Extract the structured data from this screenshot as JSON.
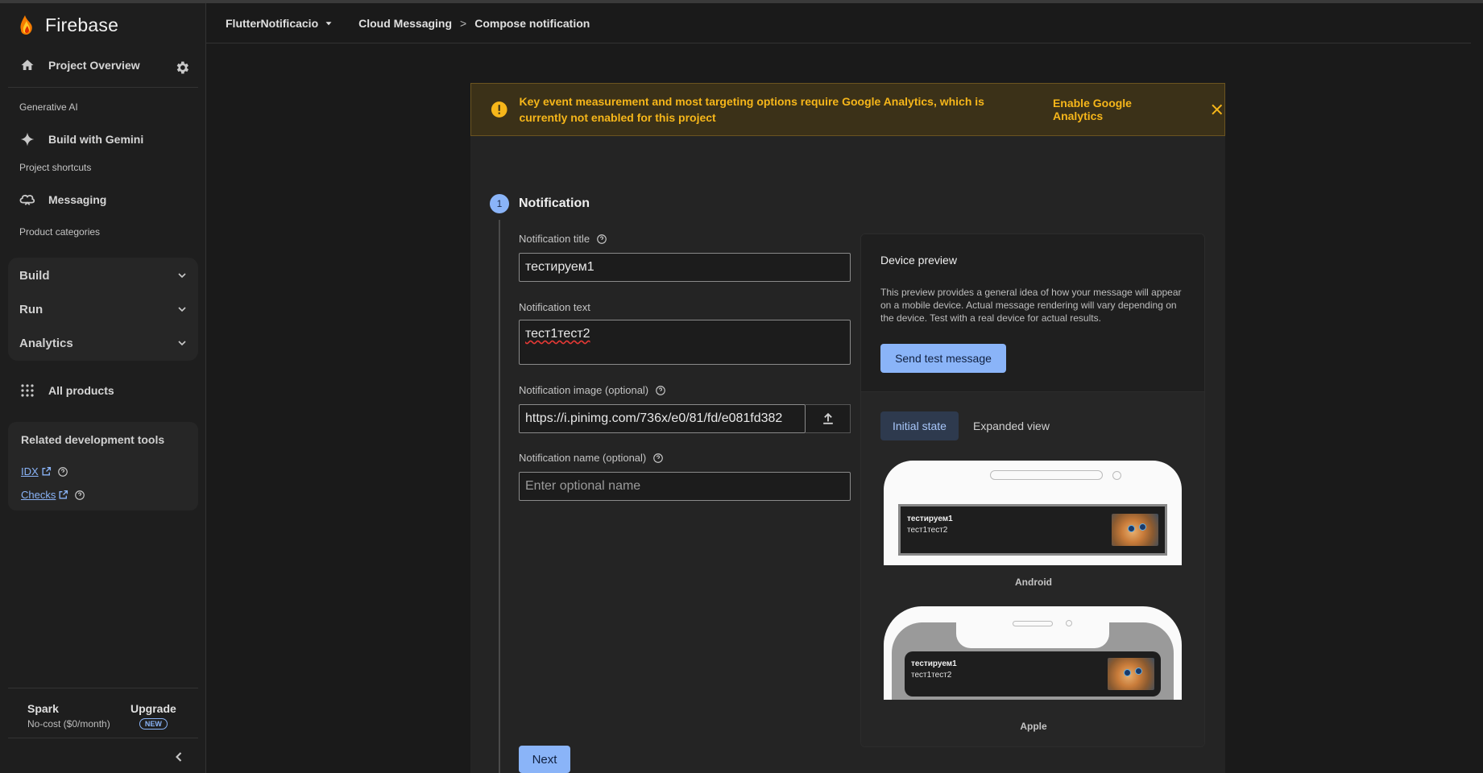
{
  "brand": {
    "name": "Firebase"
  },
  "sidebar": {
    "project_overview": "Project Overview",
    "gen_ai_label": "Generative AI",
    "build_with_gemini": "Build with Gemini",
    "shortcuts_label": "Project shortcuts",
    "messaging": "Messaging",
    "categories_label": "Product categories",
    "categories": [
      {
        "label": "Build"
      },
      {
        "label": "Run"
      },
      {
        "label": "Analytics"
      }
    ],
    "all_products": "All products",
    "tools": {
      "title": "Related development tools",
      "links": [
        {
          "label": "IDX"
        },
        {
          "label": "Checks"
        }
      ]
    },
    "plan": {
      "name": "Spark",
      "cost": "No-cost ($0/month)"
    },
    "upgrade": {
      "label": "Upgrade",
      "badge": "NEW"
    }
  },
  "header": {
    "project": "FlutterNotificacio",
    "breadcrumb": [
      "Cloud Messaging",
      "Compose notification"
    ],
    "separator": ">"
  },
  "banner": {
    "text": "Key event measurement and most targeting options require Google Analytics, which is currently not enabled for this project",
    "action": "Enable Google Analytics"
  },
  "step": {
    "number": "1",
    "title": "Notification"
  },
  "form": {
    "title_label": "Notification title",
    "title_value": "тестируем1",
    "text_label": "Notification text",
    "text_value": "тест1тест2",
    "image_label": "Notification image (optional)",
    "image_value": "https://i.pinimg.com/736x/e0/81/fd/e081fd382",
    "name_label": "Notification name (optional)",
    "name_placeholder": "Enter optional name",
    "next": "Next"
  },
  "preview": {
    "title": "Device preview",
    "description": "This preview provides a general idea of how your message will appear on a mobile device. Actual message rendering will vary depending on the device. Test with a real device for actual results.",
    "send_test": "Send test message",
    "tabs": [
      {
        "label": "Initial state",
        "active": true
      },
      {
        "label": "Expanded view",
        "active": false
      }
    ],
    "notification_title": "тестируем1",
    "notification_text": "тест1тест2",
    "android_label": "Android",
    "apple_label": "Apple"
  },
  "colors": {
    "accent": "#8ab4f8",
    "warning": "#f6b61a",
    "banner_bg": "#3b3118"
  }
}
